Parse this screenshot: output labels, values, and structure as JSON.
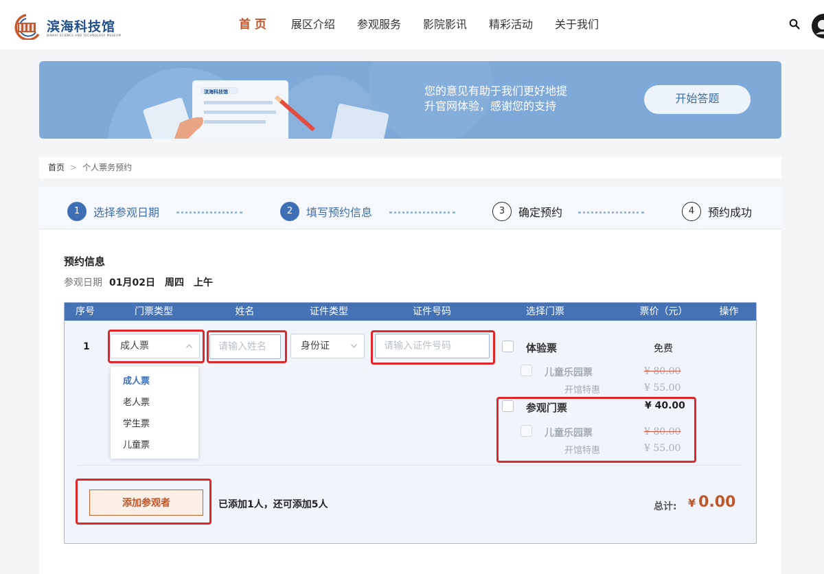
{
  "header": {
    "logo_name": "滨海科技馆",
    "logo_sub": "BINHAI SCIENCE AND TECHNOLOGY MUSEUM",
    "nav": [
      "首 页",
      "展区介绍",
      "参观服务",
      "影院影讯",
      "精彩活动",
      "关于我们"
    ],
    "active_nav_index": 0
  },
  "banner": {
    "card_text": "滨海科技馆",
    "line1": "您的意见有助于我们更好地提",
    "line2": "升官网体验，感谢您的支持",
    "button": "开始答题"
  },
  "breadcrumb": {
    "home": "首页",
    "current": "个人票务预约"
  },
  "steps": [
    {
      "num": "1",
      "label": "选择参观日期",
      "done": true
    },
    {
      "num": "2",
      "label": "填写预约信息",
      "done": true
    },
    {
      "num": "3",
      "label": "确定预约",
      "done": false
    },
    {
      "num": "4",
      "label": "预约成功",
      "done": false
    }
  ],
  "section_title": "预约信息",
  "visit": {
    "label": "参观日期",
    "date": "01月02日",
    "weekday": "周四",
    "period": "上午"
  },
  "table": {
    "headers": [
      "序号",
      "门票类型",
      "姓名",
      "证件类型",
      "证件号码",
      "选择门票",
      "票价（元）",
      "操作"
    ]
  },
  "row": {
    "no": "1",
    "ticket_type": "成人票",
    "name_placeholder": "请输入姓名",
    "id_type": "身份证",
    "id_placeholder": "请输入证件号码"
  },
  "dropdown": [
    "成人票",
    "老人票",
    "学生票",
    "儿童票"
  ],
  "tickets": [
    {
      "name": "体验票",
      "price": "免费"
    },
    {
      "name": "儿童乐园票",
      "old_price": "¥ 80.00",
      "note": "开馆特惠",
      "price": "¥ 55.00"
    },
    {
      "name": "参观门票",
      "price": "¥ 40.00"
    },
    {
      "name": "儿童乐园票",
      "old_price": "¥ 80.00",
      "note": "开馆特惠",
      "price": "¥ 55.00"
    }
  ],
  "add_button": "添加参观者",
  "add_note": "已添加1人，还可添加5人",
  "total": {
    "label": "总计:",
    "currency": "¥",
    "value": "0.00"
  },
  "colors": {
    "brand": "#c0562a",
    "primary": "#4472b5",
    "highlight": "#e0262a"
  }
}
